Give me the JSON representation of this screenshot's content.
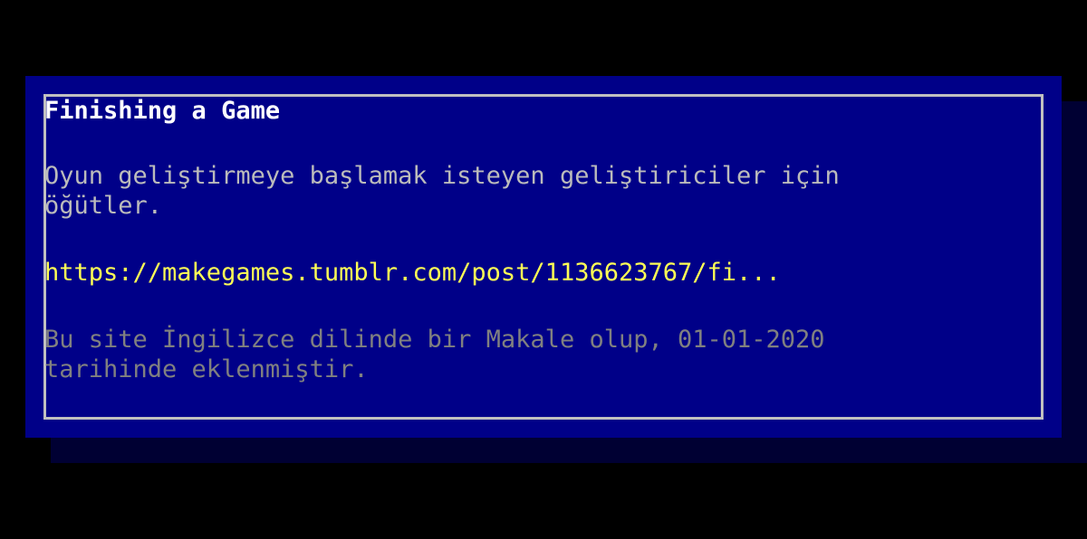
{
  "card": {
    "title": "Finishing a Game",
    "description": "Oyun geliştirmeye başlamak isteyen geliştiriciler için öğütler.",
    "link_text": "https://makegames.tumblr.com/post/1136623767/fi...",
    "meta_text": "Bu site İngilizce dilinde bir Makale olup, 01-01-2020 tarihinde eklenmiştir."
  },
  "colors": {
    "page_background": "#000000",
    "panel_background": "#000088",
    "panel_shadow": "#000033",
    "frame_border": "#c0c0c0",
    "title": "#ffffff",
    "description": "#bbbbbb",
    "link": "#ffff55",
    "meta": "#808080"
  }
}
